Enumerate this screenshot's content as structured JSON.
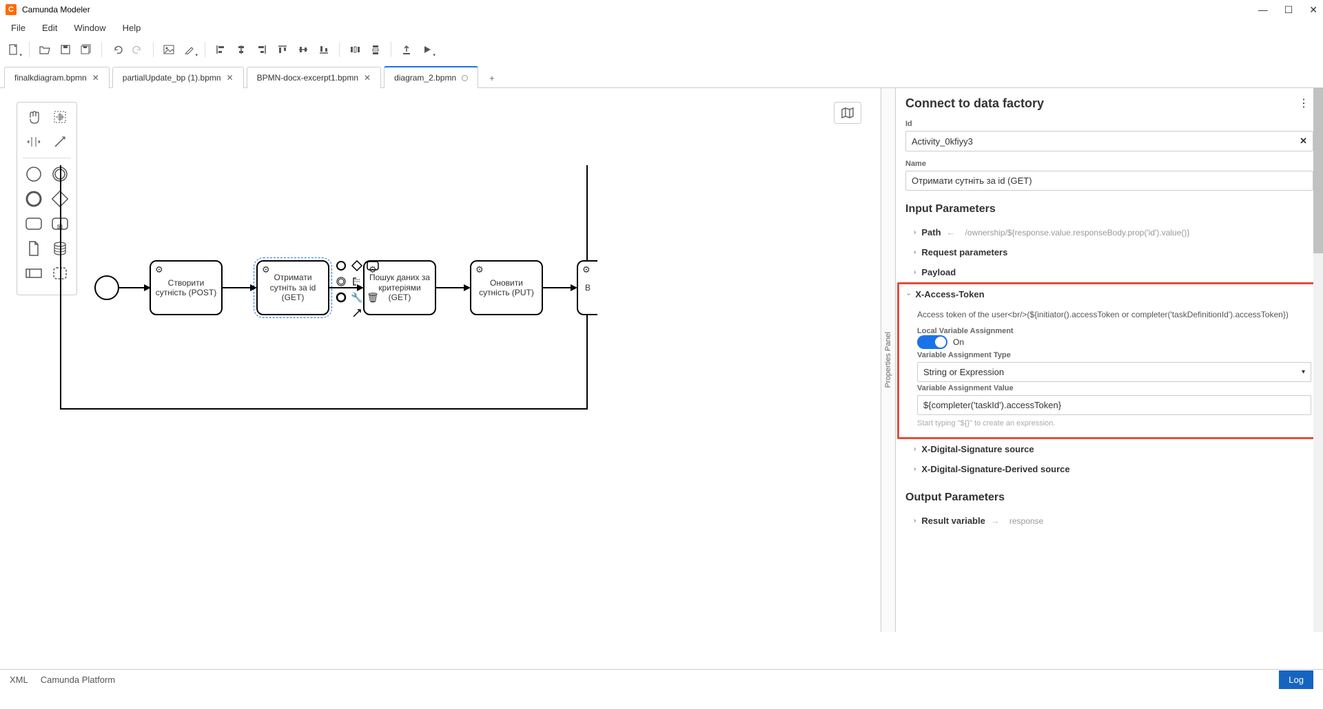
{
  "app": {
    "title": "Camunda Modeler"
  },
  "menu": {
    "items": [
      "File",
      "Edit",
      "Window",
      "Help"
    ]
  },
  "tabs": [
    {
      "label": "finalkdiagram.bpmn",
      "closeable": true
    },
    {
      "label": "partialUpdate_bp (1).bpmn",
      "closeable": true
    },
    {
      "label": "BPMN-docx-excerpt1.bpmn",
      "closeable": true
    },
    {
      "label": "diagram_2.bpmn",
      "dirty": true,
      "active": true
    }
  ],
  "diagram": {
    "tasks": [
      {
        "label": "Створити сутність (POST)"
      },
      {
        "label": "Отримати сутніть за id (GET)"
      },
      {
        "label": "Пошук даних за критеріями (GET)"
      },
      {
        "label": "Оновити сутність (PUT)"
      }
    ],
    "cut_task_prefix": "В"
  },
  "props": {
    "header": "Connect to data factory",
    "id_label": "Id",
    "id_value": "Activity_0kfiyy3",
    "name_label": "Name",
    "name_value": "Отримати сутніть за id (GET)",
    "input_params_title": "Input Parameters",
    "path": {
      "label": "Path",
      "value": "/ownership/${response.value.responseBody.prop('id').value()}"
    },
    "request_params": "Request parameters",
    "payload": "Payload",
    "xtoken": {
      "label": "X-Access-Token",
      "description": "Access token of the user<br/>(${initiator().accessToken or completer('taskDefinitionId').accessToken})",
      "local_var_label": "Local Variable Assignment",
      "toggle_state": "On",
      "var_type_label": "Variable Assignment Type",
      "var_type_value": "String or Expression",
      "var_value_label": "Variable Assignment Value",
      "var_value": "${completer('taskId').accessToken}",
      "hint": "Start typing \"${}\" to create an expression."
    },
    "xdigsig": "X-Digital-Signature source",
    "xdigsig_derived": "X-Digital-Signature-Derived source",
    "output_params_title": "Output Parameters",
    "result_var": {
      "label": "Result variable",
      "value": "response"
    }
  },
  "prop_toggle_label": "Properties Panel",
  "status": {
    "xml": "XML",
    "platform": "Camunda Platform",
    "log": "Log"
  }
}
